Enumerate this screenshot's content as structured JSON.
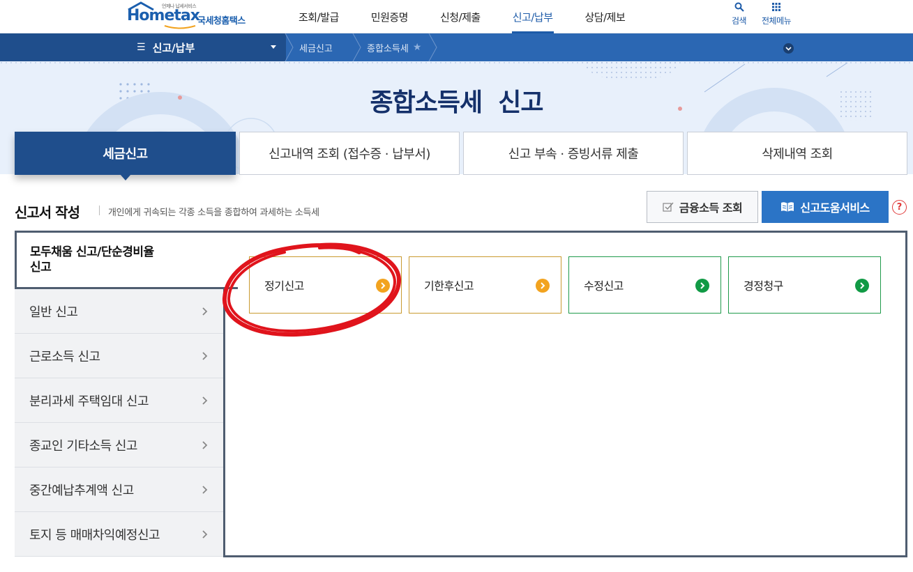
{
  "header": {
    "logo_small": "언제나 납세서비스",
    "logo_text": "Hometax",
    "logo_org": "국세청홈택스",
    "nav": [
      {
        "label": "조회/발급",
        "active": false
      },
      {
        "label": "민원증명",
        "active": false
      },
      {
        "label": "신청/제출",
        "active": false
      },
      {
        "label": "신고/납부",
        "active": true
      },
      {
        "label": "상담/제보",
        "active": false
      }
    ],
    "search_label": "검색",
    "all_menu_label": "전체메뉴"
  },
  "location": {
    "menu_label": "신고/납부",
    "crumbs": [
      "세금신고",
      "종합소득세"
    ]
  },
  "banner": {
    "title": "종합소득세  신고"
  },
  "tabs": [
    {
      "label": "세금신고",
      "active": true
    },
    {
      "label": "신고내역 조회 (접수증 · 납부서)",
      "active": false
    },
    {
      "label": "신고 부속 · 증빙서류 제출",
      "active": false
    },
    {
      "label": "삭제내역 조회",
      "active": false
    }
  ],
  "section": {
    "title": "신고서 작성",
    "description": "개인에게 귀속되는 각종 소득을 종합하여 과세하는 소득세",
    "financial_button": "금융소득 조회",
    "help_button": "신고도움서비스",
    "question_icon": "?"
  },
  "left_menu": {
    "active_item": "모두채움 신고/단순경비율\n신고",
    "items": [
      "일반 신고",
      "근로소득 신고",
      "분리과세 주택임대 신고",
      "종교인 기타소득 신고",
      "중간예납추계액 신고",
      "토지 등 매매차익예정신고"
    ]
  },
  "cards": [
    {
      "label": "정기신고",
      "style": "orange"
    },
    {
      "label": "기한후신고",
      "style": "orange"
    },
    {
      "label": "수정신고",
      "style": "green"
    },
    {
      "label": "경정청구",
      "style": "green"
    }
  ],
  "colors": {
    "brand_blue": "#1d5ba8",
    "nav_dark": "#1f4e8c",
    "orange": "#f2a31f",
    "green": "#119a45",
    "annotation_red": "#e0141c"
  }
}
